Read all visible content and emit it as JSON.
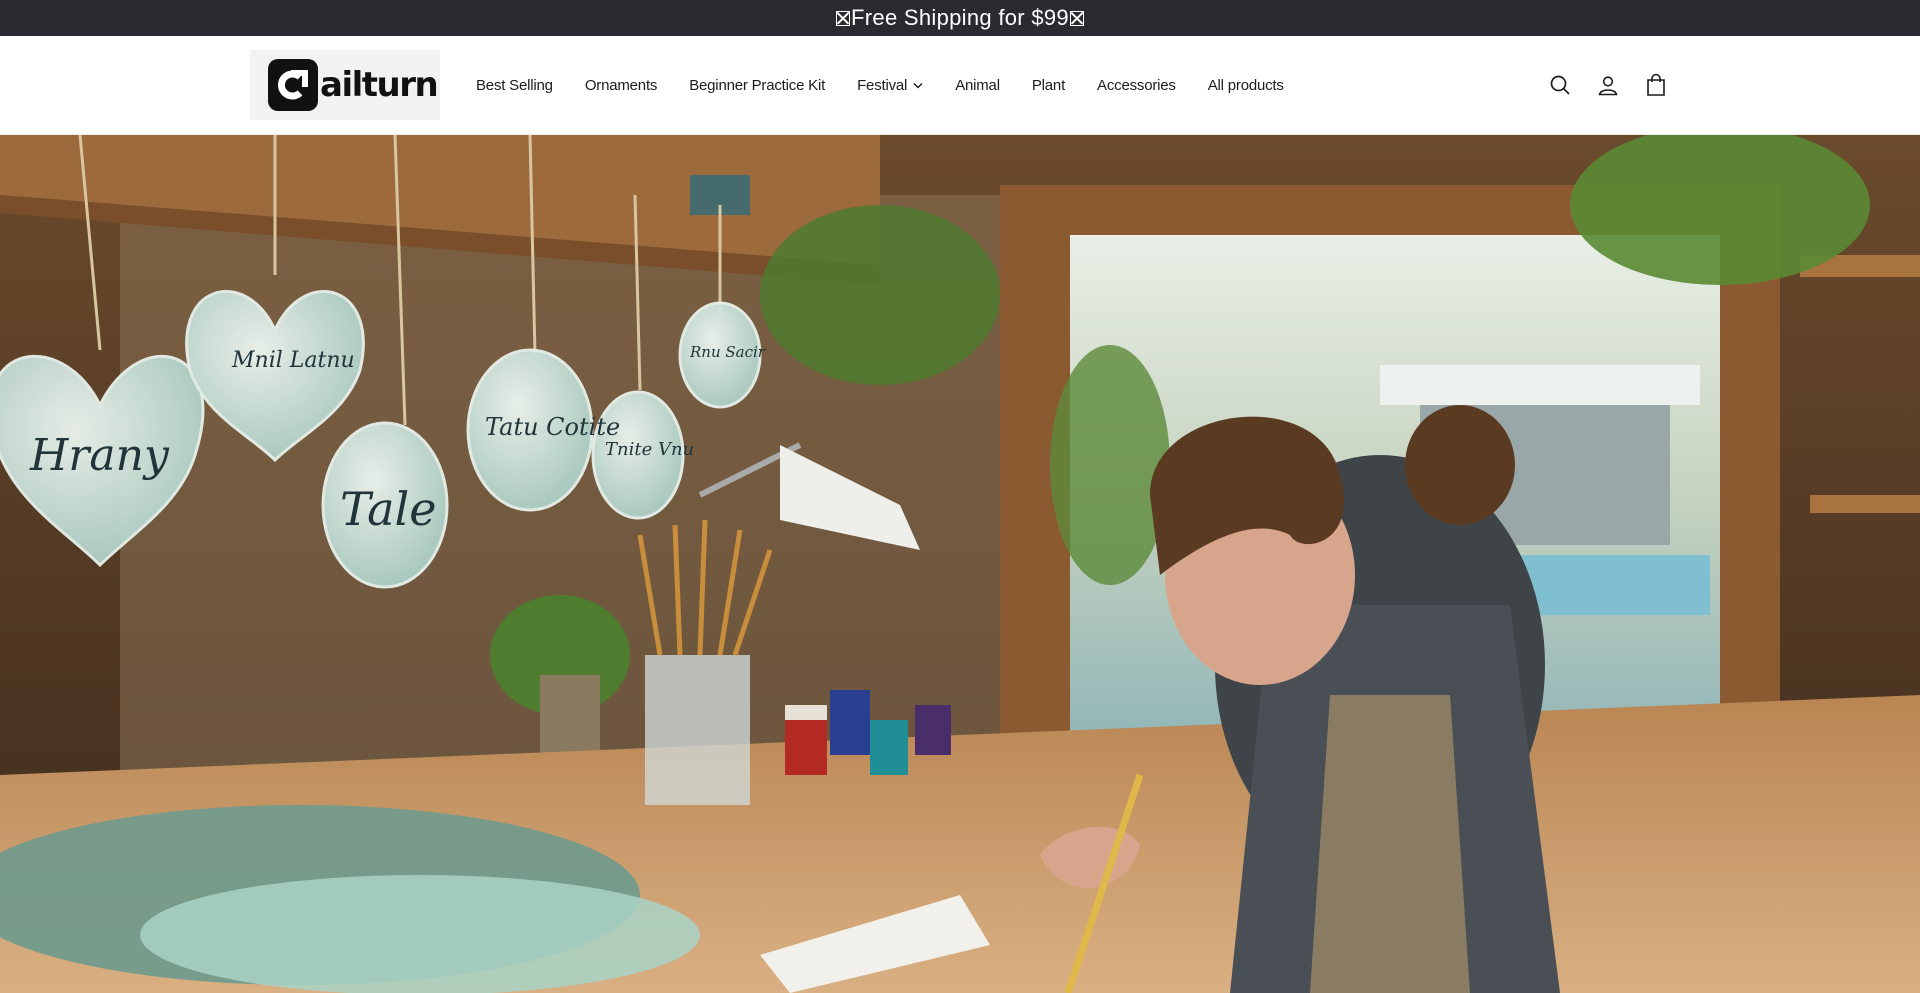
{
  "announcement": {
    "text": "Free Shipping for $99"
  },
  "brand": {
    "name": "ailturn",
    "accent": "#111111"
  },
  "nav": {
    "items": [
      {
        "label": "Best Selling"
      },
      {
        "label": "Ornaments"
      },
      {
        "label": "Beginner Practice Kit"
      },
      {
        "label": "Festival",
        "has_dropdown": true
      },
      {
        "label": "Animal"
      },
      {
        "label": "Plant"
      },
      {
        "label": "Accessories"
      },
      {
        "label": "All products"
      }
    ]
  },
  "header_icons": [
    "search-icon",
    "account-icon",
    "cart-icon"
  ],
  "hero": {
    "ornaments": [
      {
        "text": "Hrany",
        "shape": "heart"
      },
      {
        "text": "Mnil Latnu",
        "shape": "heart"
      },
      {
        "text": "Tale",
        "shape": "oval"
      },
      {
        "text": "Tatu Cotite",
        "shape": "oval"
      },
      {
        "text": "Tnite Vnu",
        "shape": "oval"
      },
      {
        "text": "Rnu Sacir",
        "shape": "oval"
      }
    ]
  }
}
